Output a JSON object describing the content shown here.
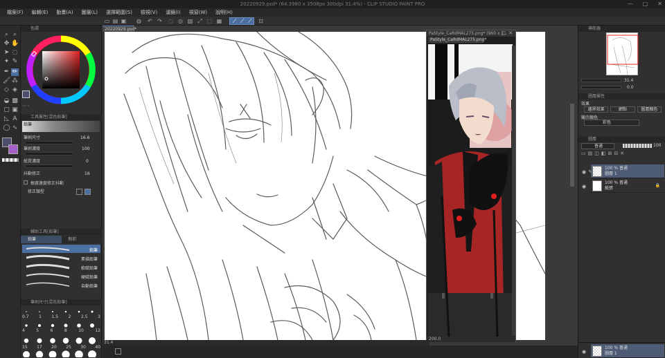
{
  "window": {
    "title": "20220929.psd* (64.3980 x 3508px 300dpi 31.4%) - CLIP STUDIO PAINT PRO",
    "minimize": "—",
    "maximize": "□",
    "close": "✕"
  },
  "menu": [
    "檔案(F)",
    "編輯(E)",
    "動畫(A)",
    "圖層(L)",
    "選擇範圍(S)",
    "檢視(V)",
    "濾鏡(I)",
    "視窗(W)",
    "說明(H)"
  ],
  "doc_tab": "20220929.psd*",
  "color_panel": {
    "tab": "色環"
  },
  "tool_property": {
    "tab": "工具屬性[混色鉛筆]",
    "brush_name": "鉛筆",
    "rows": [
      {
        "label": "筆刷尺寸",
        "value": "16.6"
      },
      {
        "label": "筆刷濃度",
        "value": "100"
      },
      {
        "label": "紙質濃度",
        "value": "0"
      },
      {
        "label": "抖動修正",
        "value": "16"
      },
      {
        "label": "根據速度修正抖動",
        "value": ""
      },
      {
        "label": "修正類型",
        "value": ""
      }
    ]
  },
  "sub_tool": {
    "tab": "輔助工具[鉛筆]",
    "tabs": [
      "鉛筆",
      "粉彩"
    ],
    "items": [
      "鉛筆",
      "素描鉛筆",
      "軟碳鉛筆",
      "硬碳鉛筆",
      "自動鉛筆"
    ]
  },
  "brush_size": {
    "tab": "筆刷尺寸[混色鉛筆]",
    "row1": [
      "0.7",
      "1",
      "1.5",
      "2",
      "2.5",
      "3"
    ],
    "row2": [
      "4",
      "5",
      "6",
      "8",
      "10",
      "12"
    ],
    "row3": [
      "15",
      "17",
      "20",
      "25",
      "30",
      "40"
    ]
  },
  "sub_window": {
    "title": "PaStyle_CaRdMAL275.png* (960 x 1...",
    "tab": "PaStyle_CaRdMAL275.png*",
    "status": "200.0"
  },
  "status_bar": {
    "zoom": "31.4"
  },
  "navigator": {
    "tab": "導航器",
    "zoom": "31.4",
    "angle": "0.0"
  },
  "layer_property": {
    "tab": "圖層屬性",
    "effect_label": "效果",
    "border": "邊界效果",
    "tone": "網點",
    "layer_color": "圖層顏色",
    "expression_label": "顯示顏色",
    "expression_value": "彩色"
  },
  "layers": {
    "tab": "圖層",
    "blend": "普通",
    "opacity": "100",
    "items": [
      {
        "percent": "100 % 普通",
        "name": "圖層 1",
        "selected": true
      },
      {
        "percent": "100 % 普通",
        "name": "紙張",
        "selected": false
      }
    ],
    "bottom_item": {
      "percent": "100 % 普通",
      "name": "圖層 1"
    }
  }
}
